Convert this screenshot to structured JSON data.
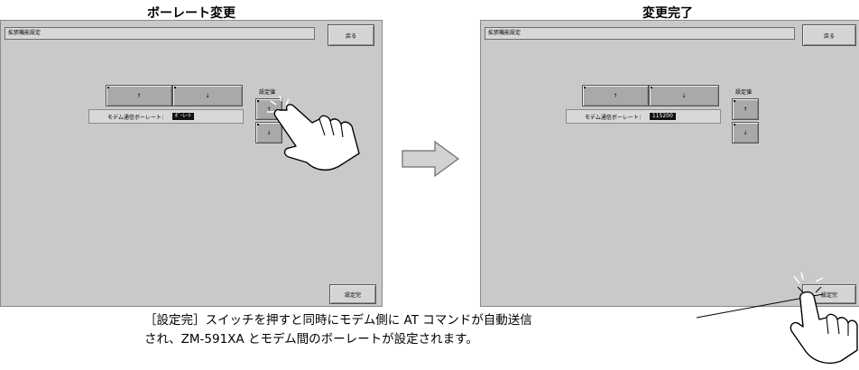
{
  "left": {
    "caption": "ボーレート変更",
    "title": "拡張機能設定",
    "back_label": "戻る",
    "up_arrow": "↑",
    "down_arrow": "↓",
    "setting_label": "設定値",
    "baud_label": "モデム通信ボーレート：",
    "baud_value": "ﾎﾞｰﾚｰﾄ",
    "finish_label": "設定完"
  },
  "right": {
    "caption": "変更完了",
    "title": "拡張機能設定",
    "back_label": "戻る",
    "up_arrow": "↑",
    "down_arrow": "↓",
    "setting_label": "設定値",
    "baud_label": "モデム通信ボーレート：",
    "baud_value": "115200",
    "finish_label": "設定完"
  },
  "footnote": {
    "line1": "［設定完］スイッチを押すと同時にモデム側に AT コマンドが自動送信",
    "line2": "され、ZM-591XA とモデム間のボーレートが設定されます。"
  },
  "colors": {
    "panel_bg": "#c9c9c9",
    "button_bg": "#d4d4d4",
    "value_bg": "#111111"
  },
  "icons": [
    "pointing-hand-icon",
    "arrow-right-icon",
    "up-arrow-icon",
    "down-arrow-icon"
  ]
}
